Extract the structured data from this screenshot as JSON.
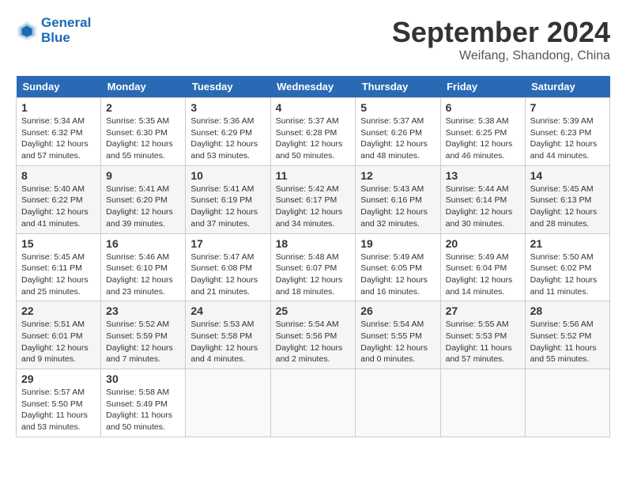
{
  "header": {
    "logo_line1": "General",
    "logo_line2": "Blue",
    "month_year": "September 2024",
    "location": "Weifang, Shandong, China"
  },
  "weekdays": [
    "Sunday",
    "Monday",
    "Tuesday",
    "Wednesday",
    "Thursday",
    "Friday",
    "Saturday"
  ],
  "weeks": [
    [
      {
        "day": 1,
        "sunrise": "5:34 AM",
        "sunset": "6:32 PM",
        "daylight": "12 hours and 57 minutes."
      },
      {
        "day": 2,
        "sunrise": "5:35 AM",
        "sunset": "6:30 PM",
        "daylight": "12 hours and 55 minutes."
      },
      {
        "day": 3,
        "sunrise": "5:36 AM",
        "sunset": "6:29 PM",
        "daylight": "12 hours and 53 minutes."
      },
      {
        "day": 4,
        "sunrise": "5:37 AM",
        "sunset": "6:28 PM",
        "daylight": "12 hours and 50 minutes."
      },
      {
        "day": 5,
        "sunrise": "5:37 AM",
        "sunset": "6:26 PM",
        "daylight": "12 hours and 48 minutes."
      },
      {
        "day": 6,
        "sunrise": "5:38 AM",
        "sunset": "6:25 PM",
        "daylight": "12 hours and 46 minutes."
      },
      {
        "day": 7,
        "sunrise": "5:39 AM",
        "sunset": "6:23 PM",
        "daylight": "12 hours and 44 minutes."
      }
    ],
    [
      {
        "day": 8,
        "sunrise": "5:40 AM",
        "sunset": "6:22 PM",
        "daylight": "12 hours and 41 minutes."
      },
      {
        "day": 9,
        "sunrise": "5:41 AM",
        "sunset": "6:20 PM",
        "daylight": "12 hours and 39 minutes."
      },
      {
        "day": 10,
        "sunrise": "5:41 AM",
        "sunset": "6:19 PM",
        "daylight": "12 hours and 37 minutes."
      },
      {
        "day": 11,
        "sunrise": "5:42 AM",
        "sunset": "6:17 PM",
        "daylight": "12 hours and 34 minutes."
      },
      {
        "day": 12,
        "sunrise": "5:43 AM",
        "sunset": "6:16 PM",
        "daylight": "12 hours and 32 minutes."
      },
      {
        "day": 13,
        "sunrise": "5:44 AM",
        "sunset": "6:14 PM",
        "daylight": "12 hours and 30 minutes."
      },
      {
        "day": 14,
        "sunrise": "5:45 AM",
        "sunset": "6:13 PM",
        "daylight": "12 hours and 28 minutes."
      }
    ],
    [
      {
        "day": 15,
        "sunrise": "5:45 AM",
        "sunset": "6:11 PM",
        "daylight": "12 hours and 25 minutes."
      },
      {
        "day": 16,
        "sunrise": "5:46 AM",
        "sunset": "6:10 PM",
        "daylight": "12 hours and 23 minutes."
      },
      {
        "day": 17,
        "sunrise": "5:47 AM",
        "sunset": "6:08 PM",
        "daylight": "12 hours and 21 minutes."
      },
      {
        "day": 18,
        "sunrise": "5:48 AM",
        "sunset": "6:07 PM",
        "daylight": "12 hours and 18 minutes."
      },
      {
        "day": 19,
        "sunrise": "5:49 AM",
        "sunset": "6:05 PM",
        "daylight": "12 hours and 16 minutes."
      },
      {
        "day": 20,
        "sunrise": "5:49 AM",
        "sunset": "6:04 PM",
        "daylight": "12 hours and 14 minutes."
      },
      {
        "day": 21,
        "sunrise": "5:50 AM",
        "sunset": "6:02 PM",
        "daylight": "12 hours and 11 minutes."
      }
    ],
    [
      {
        "day": 22,
        "sunrise": "5:51 AM",
        "sunset": "6:01 PM",
        "daylight": "12 hours and 9 minutes."
      },
      {
        "day": 23,
        "sunrise": "5:52 AM",
        "sunset": "5:59 PM",
        "daylight": "12 hours and 7 minutes."
      },
      {
        "day": 24,
        "sunrise": "5:53 AM",
        "sunset": "5:58 PM",
        "daylight": "12 hours and 4 minutes."
      },
      {
        "day": 25,
        "sunrise": "5:54 AM",
        "sunset": "5:56 PM",
        "daylight": "12 hours and 2 minutes."
      },
      {
        "day": 26,
        "sunrise": "5:54 AM",
        "sunset": "5:55 PM",
        "daylight": "12 hours and 0 minutes."
      },
      {
        "day": 27,
        "sunrise": "5:55 AM",
        "sunset": "5:53 PM",
        "daylight": "11 hours and 57 minutes."
      },
      {
        "day": 28,
        "sunrise": "5:56 AM",
        "sunset": "5:52 PM",
        "daylight": "11 hours and 55 minutes."
      }
    ],
    [
      {
        "day": 29,
        "sunrise": "5:57 AM",
        "sunset": "5:50 PM",
        "daylight": "11 hours and 53 minutes."
      },
      {
        "day": 30,
        "sunrise": "5:58 AM",
        "sunset": "5:49 PM",
        "daylight": "11 hours and 50 minutes."
      },
      null,
      null,
      null,
      null,
      null
    ]
  ]
}
